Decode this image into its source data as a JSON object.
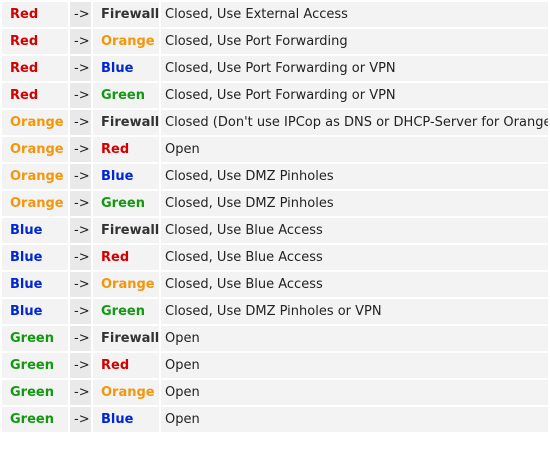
{
  "colors": {
    "red": "#d40000",
    "orange": "#f5960a",
    "blue": "#0026d6",
    "green": "#119911",
    "firewall": "#333333"
  },
  "rows": [
    {
      "from": "Red",
      "from_color": "red",
      "arrow": "->",
      "to": "Firewall",
      "to_color": "firewall",
      "desc": "Closed, Use External Access"
    },
    {
      "from": "Red",
      "from_color": "red",
      "arrow": "->",
      "to": "Orange",
      "to_color": "orange",
      "desc": "Closed, Use Port Forwarding"
    },
    {
      "from": "Red",
      "from_color": "red",
      "arrow": "->",
      "to": "Blue",
      "to_color": "blue",
      "desc": "Closed, Use Port Forwarding or VPN"
    },
    {
      "from": "Red",
      "from_color": "red",
      "arrow": "->",
      "to": "Green",
      "to_color": "green",
      "desc": "Closed, Use Port Forwarding or VPN"
    },
    {
      "from": "Orange",
      "from_color": "orange",
      "arrow": "->",
      "to": "Firewall",
      "to_color": "firewall",
      "desc": "Closed (Don't use IPCop as DNS or DHCP-Server for Orange)"
    },
    {
      "from": "Orange",
      "from_color": "orange",
      "arrow": "->",
      "to": "Red",
      "to_color": "red",
      "desc": "Open"
    },
    {
      "from": "Orange",
      "from_color": "orange",
      "arrow": "->",
      "to": "Blue",
      "to_color": "blue",
      "desc": "Closed, Use DMZ Pinholes"
    },
    {
      "from": "Orange",
      "from_color": "orange",
      "arrow": "->",
      "to": "Green",
      "to_color": "green",
      "desc": "Closed, Use DMZ Pinholes"
    },
    {
      "from": "Blue",
      "from_color": "blue",
      "arrow": "->",
      "to": "Firewall",
      "to_color": "firewall",
      "desc": "Closed, Use Blue Access"
    },
    {
      "from": "Blue",
      "from_color": "blue",
      "arrow": "->",
      "to": "Red",
      "to_color": "red",
      "desc": "Closed, Use Blue Access"
    },
    {
      "from": "Blue",
      "from_color": "blue",
      "arrow": "->",
      "to": "Orange",
      "to_color": "orange",
      "desc": "Closed, Use Blue Access"
    },
    {
      "from": "Blue",
      "from_color": "blue",
      "arrow": "->",
      "to": "Green",
      "to_color": "green",
      "desc": "Closed, Use DMZ Pinholes or VPN"
    },
    {
      "from": "Green",
      "from_color": "green",
      "arrow": "->",
      "to": "Firewall",
      "to_color": "firewall",
      "desc": "Open"
    },
    {
      "from": "Green",
      "from_color": "green",
      "arrow": "->",
      "to": "Red",
      "to_color": "red",
      "desc": "Open"
    },
    {
      "from": "Green",
      "from_color": "green",
      "arrow": "->",
      "to": "Orange",
      "to_color": "orange",
      "desc": "Open"
    },
    {
      "from": "Green",
      "from_color": "green",
      "arrow": "->",
      "to": "Blue",
      "to_color": "blue",
      "desc": "Open"
    }
  ]
}
